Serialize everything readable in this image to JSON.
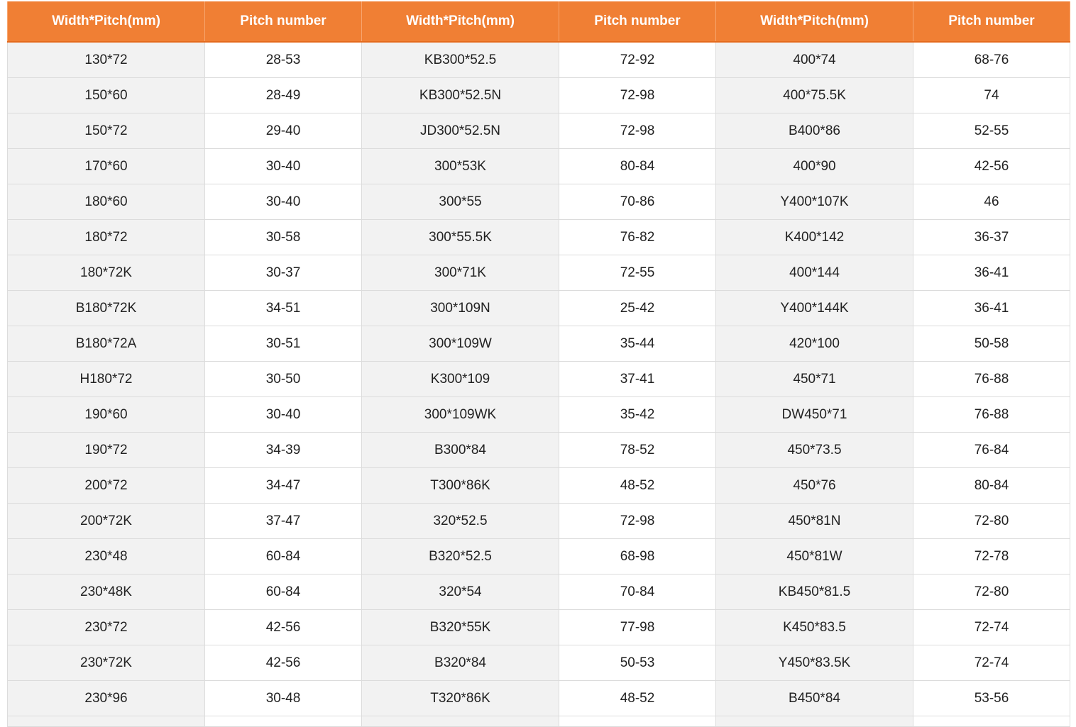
{
  "table": {
    "headers": [
      "Width*Pitch(mm)",
      "Pitch number",
      "Width*Pitch(mm)",
      "Pitch number",
      "Width*Pitch(mm)",
      "Pitch number"
    ],
    "rows": [
      [
        "130*72",
        "28-53",
        "KB300*52.5",
        "72-92",
        "400*74",
        "68-76"
      ],
      [
        "150*60",
        "28-49",
        "KB300*52.5N",
        "72-98",
        "400*75.5K",
        "74"
      ],
      [
        "150*72",
        "29-40",
        "JD300*52.5N",
        "72-98",
        "B400*86",
        "52-55"
      ],
      [
        "170*60",
        "30-40",
        "300*53K",
        "80-84",
        "400*90",
        "42-56"
      ],
      [
        "180*60",
        "30-40",
        "300*55",
        "70-86",
        "Y400*107K",
        "46"
      ],
      [
        "180*72",
        "30-58",
        "300*55.5K",
        "76-82",
        "K400*142",
        "36-37"
      ],
      [
        "180*72K",
        "30-37",
        "300*71K",
        "72-55",
        "400*144",
        "36-41"
      ],
      [
        "B180*72K",
        "34-51",
        "300*109N",
        "25-42",
        "Y400*144K",
        "36-41"
      ],
      [
        "B180*72A",
        "30-51",
        "300*109W",
        "35-44",
        "420*100",
        "50-58"
      ],
      [
        "H180*72",
        "30-50",
        "K300*109",
        "37-41",
        "450*71",
        "76-88"
      ],
      [
        "190*60",
        "30-40",
        "300*109WK",
        "35-42",
        "DW450*71",
        "76-88"
      ],
      [
        "190*72",
        "34-39",
        "B300*84",
        "78-52",
        "450*73.5",
        "76-84"
      ],
      [
        "200*72",
        "34-47",
        "T300*86K",
        "48-52",
        "450*76",
        "80-84"
      ],
      [
        "200*72K",
        "37-47",
        "320*52.5",
        "72-98",
        "450*81N",
        "72-80"
      ],
      [
        "230*48",
        "60-84",
        "B320*52.5",
        "68-98",
        "450*81W",
        "72-78"
      ],
      [
        "230*48K",
        "60-84",
        "320*54",
        "70-84",
        "KB450*81.5",
        "72-80"
      ],
      [
        "230*72",
        "42-56",
        "B320*55K",
        "77-98",
        "K450*83.5",
        "72-74"
      ],
      [
        "230*72K",
        "42-56",
        "B320*84",
        "50-53",
        "Y450*83.5K",
        "72-74"
      ],
      [
        "230*96",
        "30-48",
        "T320*86K",
        "48-52",
        "B450*84",
        "53-56"
      ]
    ]
  }
}
